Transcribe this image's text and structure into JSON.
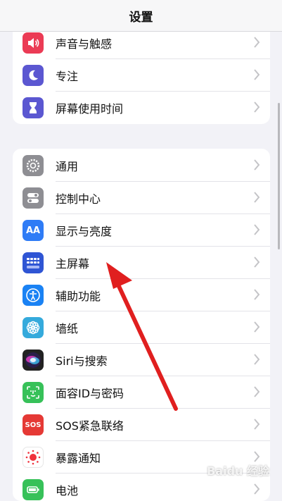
{
  "header": {
    "title": "设置"
  },
  "group1": [
    {
      "label": "声音与触感",
      "icon": "speaker-icon",
      "color": "#eb3b55"
    },
    {
      "label": "专注",
      "icon": "moon-icon",
      "color": "#5b57d1"
    },
    {
      "label": "屏幕使用时间",
      "icon": "hourglass-icon",
      "color": "#5b57d1"
    }
  ],
  "group2": [
    {
      "label": "通用",
      "icon": "gear-icon",
      "color": "#8e8e93"
    },
    {
      "label": "控制中心",
      "icon": "toggles-icon",
      "color": "#8e8e93"
    },
    {
      "label": "显示与亮度",
      "icon": "text-size-icon",
      "color": "#2f7cf6",
      "icon_text": "AA"
    },
    {
      "label": "主屏幕",
      "icon": "home-grid-icon",
      "color": "#2f55d4"
    },
    {
      "label": "辅助功能",
      "icon": "accessibility-icon",
      "color": "#1a82f4"
    },
    {
      "label": "墙纸",
      "icon": "wallpaper-flower-icon",
      "color": "#35aadc"
    },
    {
      "label": "Siri与搜索",
      "icon": "siri-icon",
      "color": "#222222"
    },
    {
      "label": "面容ID与密码",
      "icon": "face-id-icon",
      "color": "#37c159"
    },
    {
      "label": "SOS紧急联络",
      "icon": "sos-icon",
      "color": "#e53935",
      "icon_text": "SOS"
    },
    {
      "label": "暴露通知",
      "icon": "exposure-icon",
      "color": "#ffffff"
    },
    {
      "label": "电池",
      "icon": "battery-icon",
      "color": "#37c159"
    }
  ],
  "watermark": "Baidu 经验",
  "colors": {
    "background": "#f2f2f7",
    "arrow": "#e01f1f",
    "chevron": "#c4c4c7"
  }
}
